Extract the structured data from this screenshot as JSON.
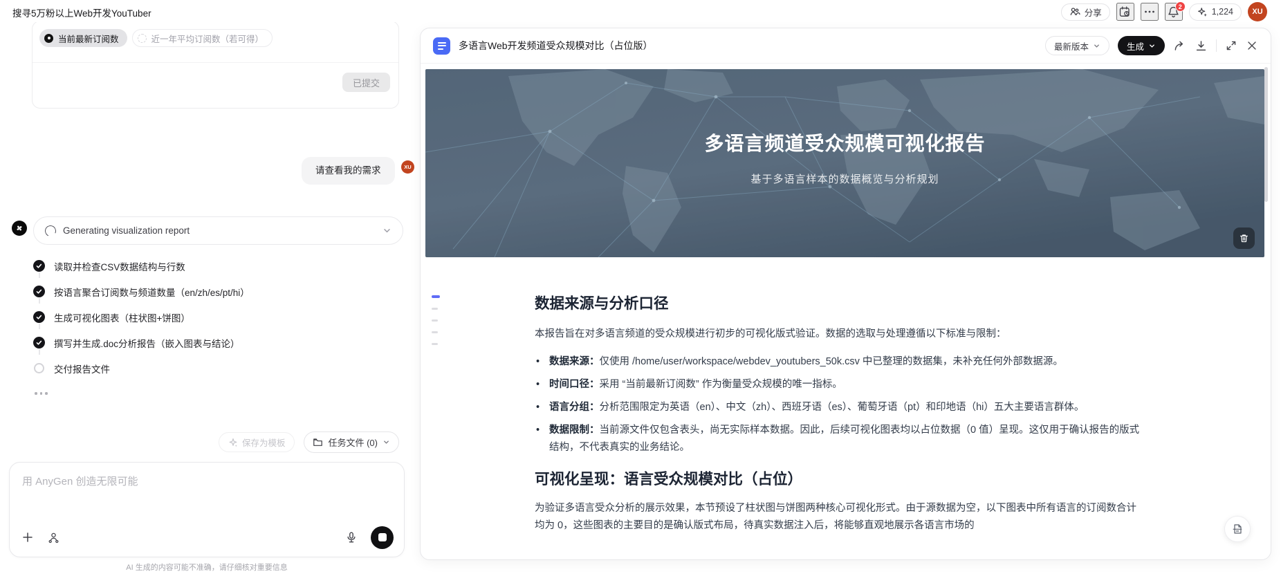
{
  "topbar": {
    "title": "搜寻5万粉以上Web开发YouTuber",
    "share_label": "分享",
    "notification_count": "2",
    "credits": "1,224",
    "avatar_initials": "XU"
  },
  "form_card": {
    "option_selected": "当前最新订阅数",
    "option_alt": "近一年平均订阅数（若可得）",
    "submitted_label": "已提交"
  },
  "chat": {
    "user_message": "请查看我的需求",
    "user_avatar": "XU",
    "status_title": "Generating visualization report",
    "tasks": [
      {
        "label": "读取并检查CSV数据结构与行数",
        "done": true
      },
      {
        "label": "按语言聚合订阅数与频道数量（en/zh/es/pt/hi）",
        "done": true
      },
      {
        "label": "生成可视化图表（柱状图+饼图）",
        "done": true
      },
      {
        "label": "撰写并生成.doc分析报告（嵌入图表与结论）",
        "done": true
      },
      {
        "label": "交付报告文件",
        "done": false
      }
    ],
    "save_template_label": "保存为模板",
    "task_files_label": "任务文件 (0)",
    "input_placeholder": "用 AnyGen 创造无限可能",
    "disclaimer": "AI 生成的内容可能不准确，请仔细核对重要信息"
  },
  "doc_panel": {
    "title": "多语言Web开发频道受众规模对比（占位版）",
    "version_label": "最新版本",
    "generate_label": "生成",
    "hero": {
      "title": "多语言频道受众规模可视化报告",
      "subtitle": "基于多语言样本的数据概览与分析规划"
    },
    "sections": [
      {
        "heading": "数据来源与分析口径",
        "intro": "本报告旨在对多语言频道的受众规模进行初步的可视化版式验证。数据的选取与处理遵循以下标准与限制：",
        "bullets": [
          {
            "term": "数据来源：",
            "text": "仅使用 /home/user/workspace/webdev_youtubers_50k.csv 中已整理的数据集，未补充任何外部数据源。"
          },
          {
            "term": "时间口径：",
            "text": "采用 “当前最新订阅数” 作为衡量受众规模的唯一指标。"
          },
          {
            "term": "语言分组：",
            "text": "分析范围限定为英语（en）、中文（zh）、西班牙语（es）、葡萄牙语（pt）和印地语（hi）五大主要语言群体。"
          },
          {
            "term": "数据限制：",
            "text": "当前源文件仅包含表头，尚无实际样本数据。因此，后续可视化图表均以占位数据（0 值）呈现。这仅用于确认报告的版式结构，不代表真实的业务结论。"
          }
        ]
      },
      {
        "heading": "可视化呈现：语言受众规模对比（占位）",
        "intro": "为验证多语言受众分析的展示效果，本节预设了柱状图与饼图两种核心可视化形式。由于源数据为空，以下图表中所有语言的订阅数合计均为 0，这些图表的主要目的是确认版式布局，待真实数据注入后，将能够直观地展示各语言市场的"
      }
    ]
  },
  "icons": {
    "share": "two-people",
    "calendar": "calendar-clock",
    "more": "ellipsis",
    "notifications": "bell",
    "credits": "sparkle",
    "doc": "document",
    "export": "share-arrow",
    "download": "download",
    "expand": "expand",
    "close": "x",
    "trash": "trash",
    "mic": "microphone",
    "stop": "stop-square",
    "add": "plus",
    "agent": "person-nodes",
    "folder": "folder",
    "save": "sparkle",
    "float": "document-page"
  },
  "colors": {
    "accent_blue": "#4a6af5",
    "avatar_red": "#c2441f",
    "badge_red": "#ef4444",
    "generate_black": "#131316",
    "hero_top": "#66798b",
    "hero_bottom": "#4d6072"
  }
}
